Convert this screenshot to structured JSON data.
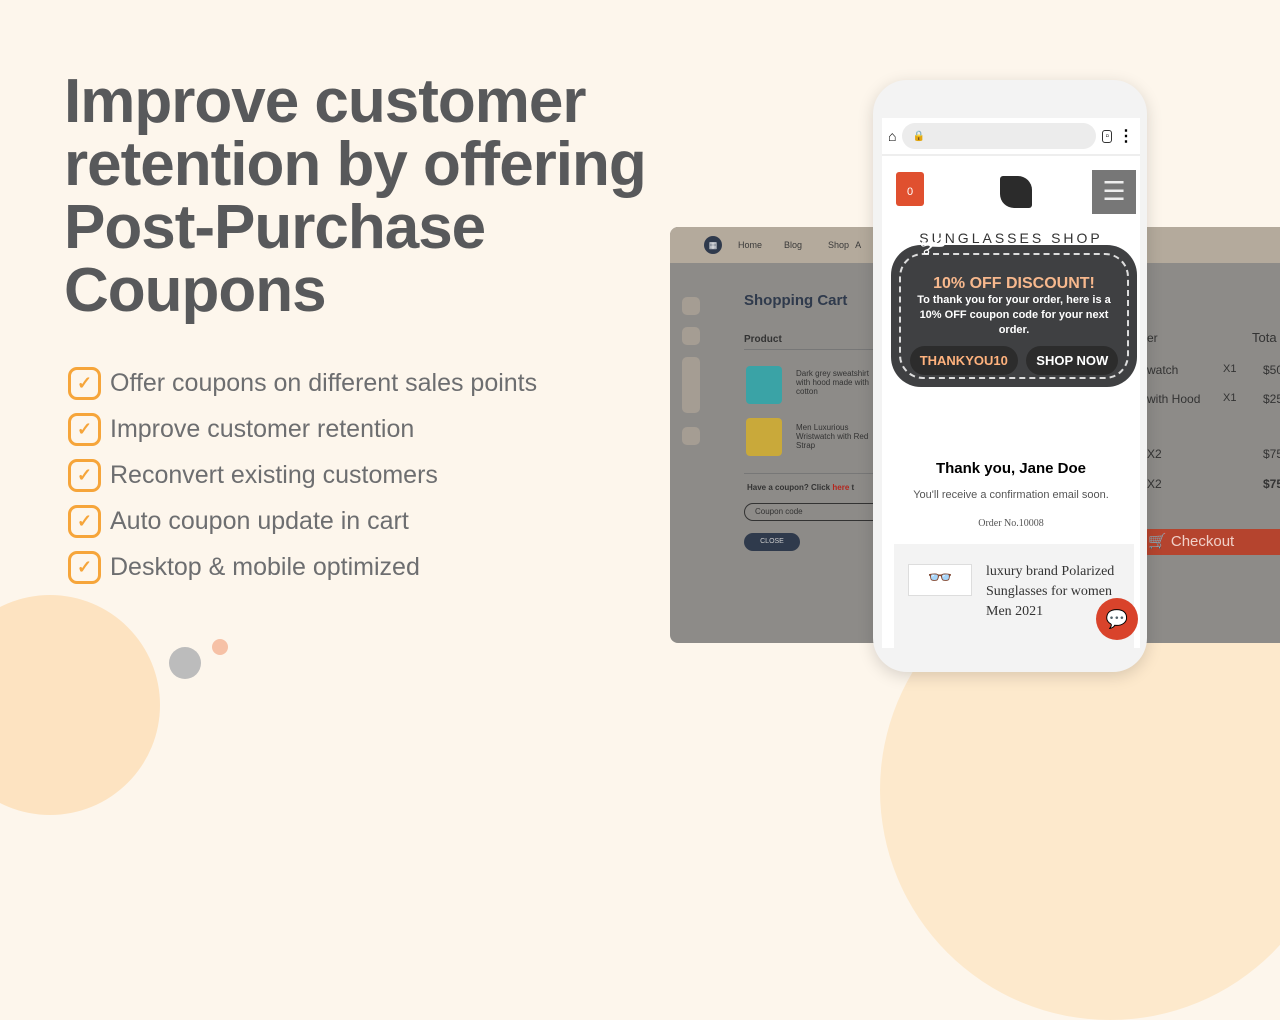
{
  "headline": [
    "Improve customer",
    "retention by offering",
    "Post-Purchase",
    "Coupons"
  ],
  "features": [
    "Offer coupons on different sales points",
    "Improve customer retention",
    "Reconvert existing customers",
    "Auto coupon update in cart",
    "Desktop & mobile optimized"
  ],
  "colors": {
    "accent": "#f6a53a",
    "headline": "#58595b",
    "background": "#fdf6ec",
    "checkout": "#d9432b"
  },
  "desktop": {
    "nav": [
      "Home",
      "Blog",
      "Shop",
      "A"
    ],
    "title": "Shopping Cart",
    "product_header": "Product",
    "total_header": "Tota",
    "col_header": "er",
    "products": [
      "Dark grey sweatshirt with hood made with cotton",
      "Men Luxurious Wristwatch with Red Strap"
    ],
    "rows": [
      {
        "name": "watch",
        "qty": "X1",
        "price": "$50"
      },
      {
        "name": "with Hood",
        "qty": "X1",
        "price": "$25"
      },
      {
        "name": "",
        "qty": "X2",
        "price": "$75"
      },
      {
        "name": "",
        "qty": "X2",
        "price": "$75"
      }
    ],
    "coupon_prompt": "Have a coupon? Click",
    "coupon_link": "here",
    "coupon_after": "t",
    "coupon_placeholder": "Coupon code",
    "close_label": "CLOSE",
    "checkout_label": "Checkout"
  },
  "mobile": {
    "cart_count": "0",
    "shop_name": "SUNGLASSES SHOP",
    "coupon_title": "10% OFF DISCOUNT!",
    "coupon_text": "To thank you for your order, here is a 10% OFF coupon code for your next order.",
    "coupon_code": "THANKYOU10",
    "shop_now": "SHOP NOW",
    "thanks": "Thank you, Jane Doe",
    "confirm": "You'll receive a confirmation email soon.",
    "order": "Order No.10008",
    "product": "luxury brand Polarized Sunglasses for women Men 2021"
  }
}
